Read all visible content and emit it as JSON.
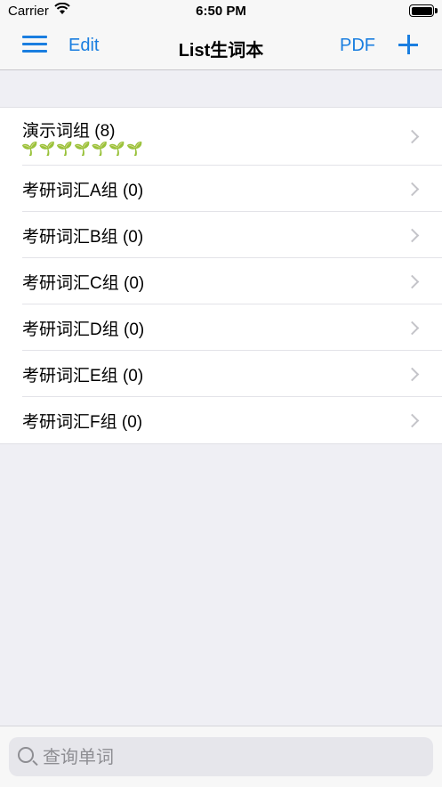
{
  "status_bar": {
    "carrier": "Carrier",
    "time": "6:50 PM",
    "icons": [
      "wifi-icon",
      "battery-icon"
    ]
  },
  "nav": {
    "menu_icon": "hamburger-menu-icon",
    "edit_label": "Edit",
    "title": "List生词本",
    "pdf_label": "PDF",
    "add_icon": "plus-icon"
  },
  "groups": [
    {
      "label": "演示词组 (8)",
      "sprouts": "🌱🌱🌱🌱🌱🌱🌱"
    },
    {
      "label": "考研词汇A组 (0)"
    },
    {
      "label": "考研词汇B组 (0)"
    },
    {
      "label": "考研词汇C组 (0)"
    },
    {
      "label": "考研词汇D组 (0)"
    },
    {
      "label": "考研词汇E组 (0)"
    },
    {
      "label": "考研词汇F组 (0)"
    }
  ],
  "search": {
    "placeholder": "查询单词",
    "value": ""
  },
  "colors": {
    "accent": "#1a7ee0",
    "background": "#efeff4"
  }
}
